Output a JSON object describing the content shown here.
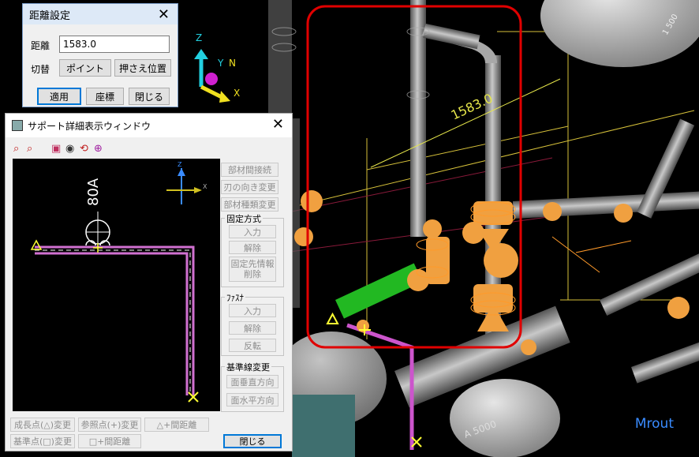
{
  "dist_dialog": {
    "title": "距離設定",
    "close": "✕",
    "distance_label": "距離",
    "distance_value": "1583.0",
    "toggle_label": "切替",
    "point_btn": "ポイント",
    "hold_btn": "押さえ位置",
    "apply_btn": "適用",
    "coord_btn": "座標",
    "close_btn": "閉じる"
  },
  "support_window": {
    "title": "サポート詳細表示ウィンドウ",
    "close": "✕",
    "canvas": {
      "size_label": "80A",
      "axis_z": "Z",
      "axis_x": "X"
    },
    "buttons": {
      "member_connect": "部材間接続",
      "blade_dir": "刃の向き変更",
      "member_type": "部材種類変更"
    },
    "fix_group": {
      "title": "固定方式",
      "input": "入力",
      "remove": "解除",
      "fix_info_line1": "固定先情報",
      "fix_info_line2": "削除"
    },
    "fastener_group": {
      "title": "ﾌｧｽﾅ",
      "input": "入力",
      "remove": "解除",
      "invert": "反転"
    },
    "baseline_group": {
      "title": "基準線変更",
      "vertical": "面垂直方向",
      "horizontal": "面水平方向"
    },
    "bottom": {
      "grow_point": "成長点(△)変更",
      "ref_point": "参照点(+)変更",
      "tri_dist": "△+間距離",
      "base_point": "基準点(□)変更",
      "sq_dist": "□+間距離",
      "close": "閉じる"
    }
  },
  "viewport": {
    "dimension_label": "1583.0",
    "axis_z": "Z",
    "axis_y": "Y",
    "axis_n": "N",
    "axis_x": "X",
    "pipe_label": "A 5000",
    "corner_label": "1 500",
    "view_name": "Mrout",
    "colors": {
      "pipe": "#9a9a9a",
      "support": "#f0a040",
      "highlight": "#e00000",
      "selected": "#22b822",
      "dimension": "#e6e64a"
    }
  }
}
